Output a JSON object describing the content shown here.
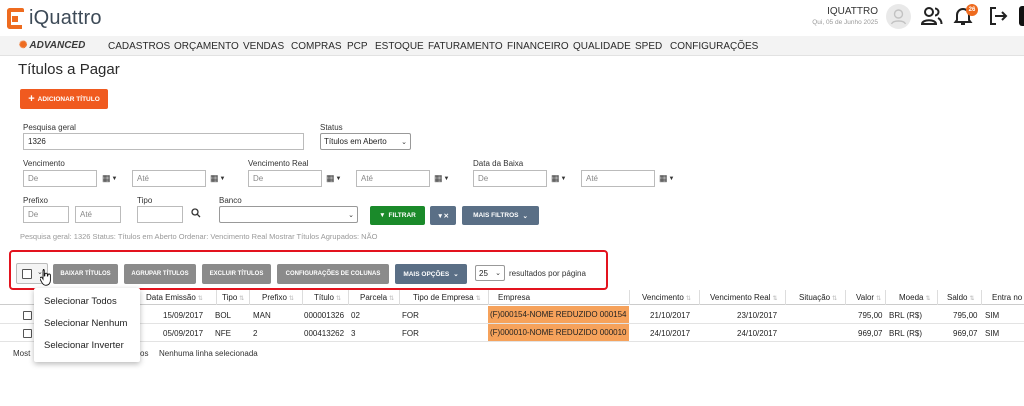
{
  "header": {
    "logo_text": "iQuattro",
    "user_name": "IQUATTRO",
    "user_date": "Qui, 05 de Junho 2025",
    "notification_count": "26",
    "brand_color": "#ee6b1f"
  },
  "menu": {
    "advanced_label": "ADVANCED",
    "items": [
      "CADASTROS",
      "ORÇAMENTO",
      "VENDAS",
      "COMPRAS",
      "PCP",
      "ESTOQUE",
      "FATURAMENTO",
      "FINANCEIRO",
      "QUALIDADE",
      "SPED",
      "CONFIGURAÇÕES"
    ]
  },
  "page": {
    "title": "Títulos a Pagar",
    "add_button": "ADICIONAR TÍTULO"
  },
  "filters": {
    "search_label": "Pesquisa geral",
    "search_value": "1326",
    "status_label": "Status",
    "status_value": "Títulos em Aberto",
    "vencimento_label": "Vencimento",
    "vencimento_real_label": "Vencimento Real",
    "data_baixa_label": "Data da Baixa",
    "from_placeholder": "De",
    "to_placeholder": "Até",
    "prefixo_label": "Prefixo",
    "tipo_label": "Tipo",
    "banco_label": "Banco",
    "filter_button": "FILTRAR",
    "more_filters_button": "MAIS FILTROS",
    "summary": "Pesquisa geral: 1326   Status: Títulos em Aberto   Ordenar: Vencimento Real   Mostrar Títulos Agrupados: NÃO"
  },
  "toolbar": {
    "baixar": "BAIXAR TÍTULOS",
    "agrupar": "AGRUPAR TÍTULOS",
    "excluir": "EXCLUIR TÍTULOS",
    "config_colunas": "CONFIGURAÇÕES DE COLUNAS",
    "mais_opcoes": "MAIS OPÇÕES",
    "per_page": "25",
    "per_page_label": "resultados por página"
  },
  "table": {
    "headers": {
      "data_emissao": "Data Emissão",
      "tipo": "Tipo",
      "prefixo": "Prefixo",
      "titulo": "Título",
      "parcela": "Parcela",
      "tipo_empresa": "Tipo de Empresa",
      "empresa": "Empresa",
      "vencimento": "Vencimento",
      "vencimento_real": "Vencimento Real",
      "situacao": "Situação",
      "valor": "Valor",
      "moeda": "Moeda",
      "saldo": "Saldo",
      "entra_no": "Entra no"
    },
    "rows": [
      {
        "data_emissao": "15/09/2017",
        "tipo": "BOL",
        "prefixo": "MAN",
        "titulo": "000001326",
        "parcela": "02",
        "tipo_empresa": "FOR",
        "empresa": "(F)000154-NOME REDUZIDO 000154",
        "vencimento": "21/10/2017",
        "vencimento_real": "23/10/2017",
        "valor": "795,00",
        "moeda": "BRL (R$)",
        "saldo": "795,00",
        "entra_no": "SIM"
      },
      {
        "data_emissao": "05/09/2017",
        "tipo": "NFE",
        "prefixo": "2",
        "titulo": "000413262",
        "parcela": "3",
        "tipo_empresa": "FOR",
        "empresa": "(F)000010-NOME REDUZIDO 000010",
        "vencimento": "24/10/2017",
        "vencimento_real": "24/10/2017",
        "valor": "969,07",
        "moeda": "BRL (R$)",
        "saldo": "969,07",
        "entra_no": "SIM"
      }
    ],
    "footer_left": "Most",
    "footer_mid": "os",
    "footer_selection": "Nenhuma linha selecionada"
  },
  "dropdown": {
    "items": [
      "Selecionar Todos",
      "Selecionar Nenhum",
      "Selecionar Inverter"
    ]
  }
}
